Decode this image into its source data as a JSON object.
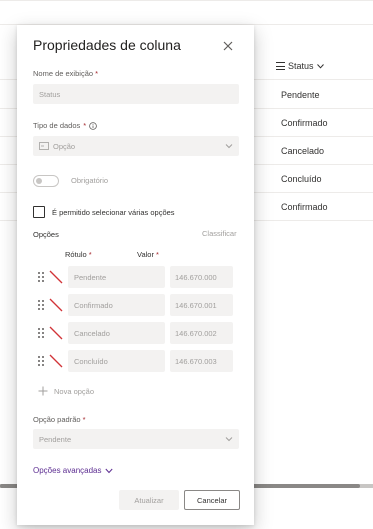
{
  "background": {
    "column_header": "Status",
    "rows": [
      "Pendente",
      "Confirmado",
      "Cancelado",
      "Concluído",
      "Confirmado"
    ]
  },
  "panel": {
    "title": "Propriedades de coluna",
    "display_name": {
      "label": "Nome de exibição",
      "required_mark": "*",
      "value": "Status"
    },
    "data_type": {
      "label": "Tipo de dados",
      "required_mark": "*",
      "value": "Opção"
    },
    "required_toggle": {
      "label": "Obrigatório",
      "on": false
    },
    "multi_select": {
      "label": "É permitido selecionar várias opções",
      "checked": false
    },
    "options_section": {
      "label": "Opções",
      "sort_label": "Classificar",
      "label_header": "Rótulo",
      "value_header": "Valor",
      "required_mark": "*",
      "items": [
        {
          "label": "Pendente",
          "value": "146.670.000"
        },
        {
          "label": "Confirmado",
          "value": "146.670.001"
        },
        {
          "label": "Cancelado",
          "value": "146.670.002"
        },
        {
          "label": "Concluído",
          "value": "146.670.003"
        }
      ],
      "add_label": "Nova opção"
    },
    "default_option": {
      "label": "Opção padrão",
      "required_mark": "*",
      "value": "Pendente"
    },
    "advanced_label": "Opções avançadas",
    "update_button": "Atualizar",
    "cancel_button": "Cancelar"
  },
  "colors": {
    "accent_link": "#5c2d91",
    "required": "#a4262c",
    "swatch_slash": "#d13438"
  }
}
